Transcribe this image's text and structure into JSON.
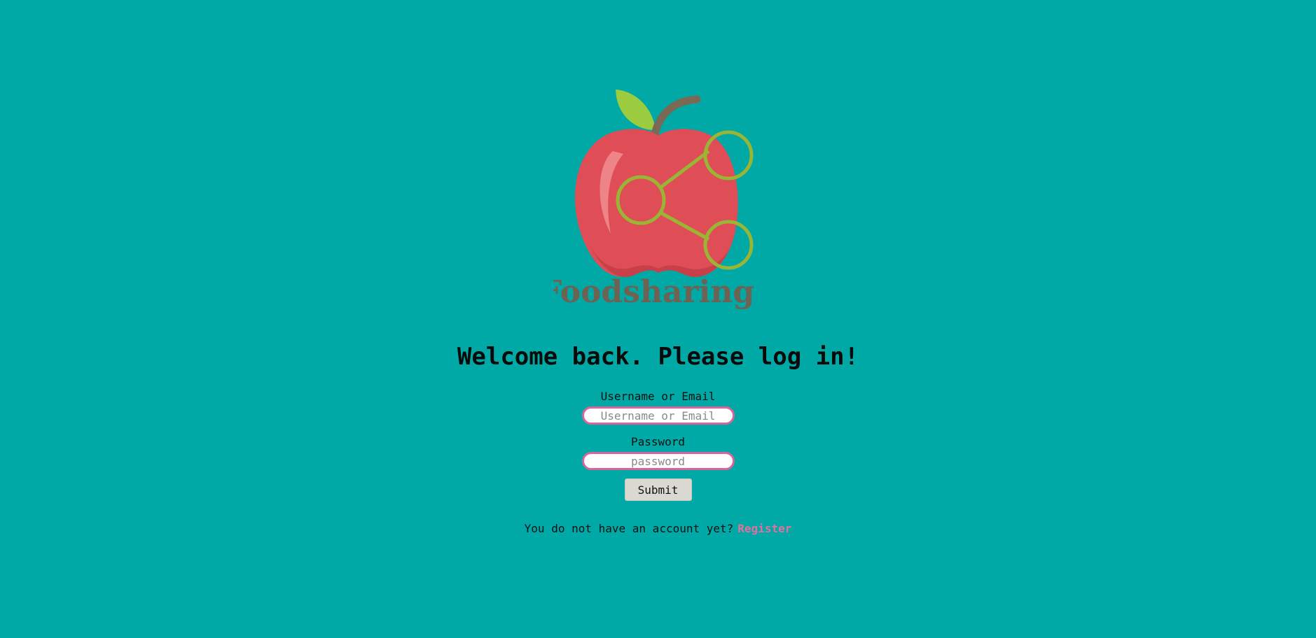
{
  "logo": {
    "wordmark": "Foodsharing"
  },
  "heading": "Welcome back. Please log in!",
  "form": {
    "username": {
      "label": "Username or Email",
      "placeholder": "Username or Email",
      "value": ""
    },
    "password": {
      "label": "Password",
      "placeholder": "password",
      "value": ""
    },
    "submit_label": "Submit"
  },
  "register": {
    "prompt": "You do not have an account yet?",
    "link_label": "Register"
  },
  "colors": {
    "background": "#00a9a5",
    "accent": "#d8649b",
    "link": "#e0719f",
    "apple": "#df4d57",
    "leaf": "#9ccc3f",
    "stem": "#7a6a55",
    "wordmark": "#6e6253"
  }
}
